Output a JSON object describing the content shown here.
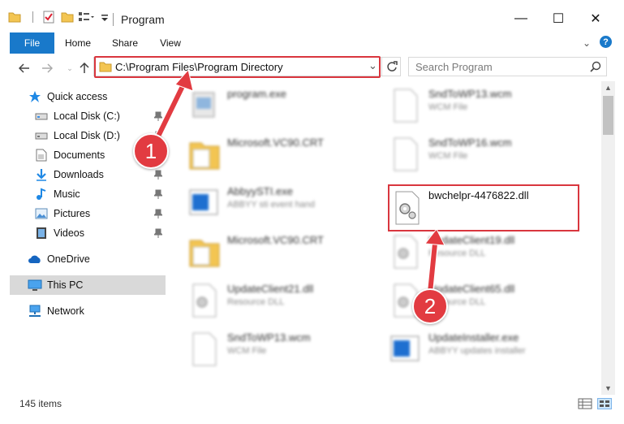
{
  "window": {
    "title": "Program",
    "minimize_glyph": "—",
    "maximize_glyph": "☐",
    "close_glyph": "✕"
  },
  "ribbon": {
    "tabs": [
      {
        "label": "File"
      },
      {
        "label": "Home"
      },
      {
        "label": "Share"
      },
      {
        "label": "View"
      }
    ]
  },
  "address": {
    "path": "C:\\Program Files\\Program Directory",
    "search_placeholder": "Search Program"
  },
  "sidebar": {
    "items": [
      {
        "label": "Quick access",
        "icon": "star-icon"
      },
      {
        "label": "Local Disk (C:)",
        "icon": "drive-icon"
      },
      {
        "label": "Local Disk (D:)",
        "icon": "drive-icon"
      },
      {
        "label": "Documents",
        "icon": "documents-icon"
      },
      {
        "label": "Downloads",
        "icon": "downloads-icon"
      },
      {
        "label": "Music",
        "icon": "music-icon"
      },
      {
        "label": "Pictures",
        "icon": "pictures-icon"
      },
      {
        "label": "Videos",
        "icon": "videos-icon"
      },
      {
        "label": "OneDrive",
        "icon": "cloud-icon"
      },
      {
        "label": "This PC",
        "icon": "computer-icon"
      },
      {
        "label": "Network",
        "icon": "network-icon"
      }
    ]
  },
  "files": [
    {
      "name": "program.exe",
      "sub": "",
      "icon": "exe-icon"
    },
    {
      "name": "SndToWP13.wcm",
      "sub": "WCM File",
      "icon": "generic-file-icon"
    },
    {
      "name": "Microsoft.VC90.CRT",
      "sub": "",
      "icon": "folder-icon"
    },
    {
      "name": "SndToWP16.wcm",
      "sub": "WCM File",
      "icon": "generic-file-icon"
    },
    {
      "name": "AbbyySTI.exe",
      "sub": "ABBYY sti event hand",
      "icon": "app-window-icon"
    },
    {
      "name": "bwchelpr-4476822.dll",
      "sub": "",
      "icon": "dll-gear-icon"
    },
    {
      "name": "Microsoft.VC90.CRT",
      "sub": "",
      "icon": "folder-icon"
    },
    {
      "name": "UpdateClient19.dll",
      "sub": "Resource DLL",
      "icon": "dll-gear-icon"
    },
    {
      "name": "UpdateClient21.dll",
      "sub": "Resource DLL",
      "icon": "dll-gear-icon"
    },
    {
      "name": "UpdateClient65.dll",
      "sub": "Resource DLL",
      "icon": "dll-gear-icon"
    },
    {
      "name": "SndToWP13.wcm",
      "sub": "WCM File",
      "icon": "generic-file-icon"
    },
    {
      "name": "UpdateInstaller.exe",
      "sub": "ABBYY updates installer",
      "icon": "app-window-icon"
    }
  ],
  "status": {
    "item_count": "145 items"
  },
  "annotations": {
    "badge1": "1",
    "badge2": "2",
    "highlight_color": "#d9363e"
  }
}
